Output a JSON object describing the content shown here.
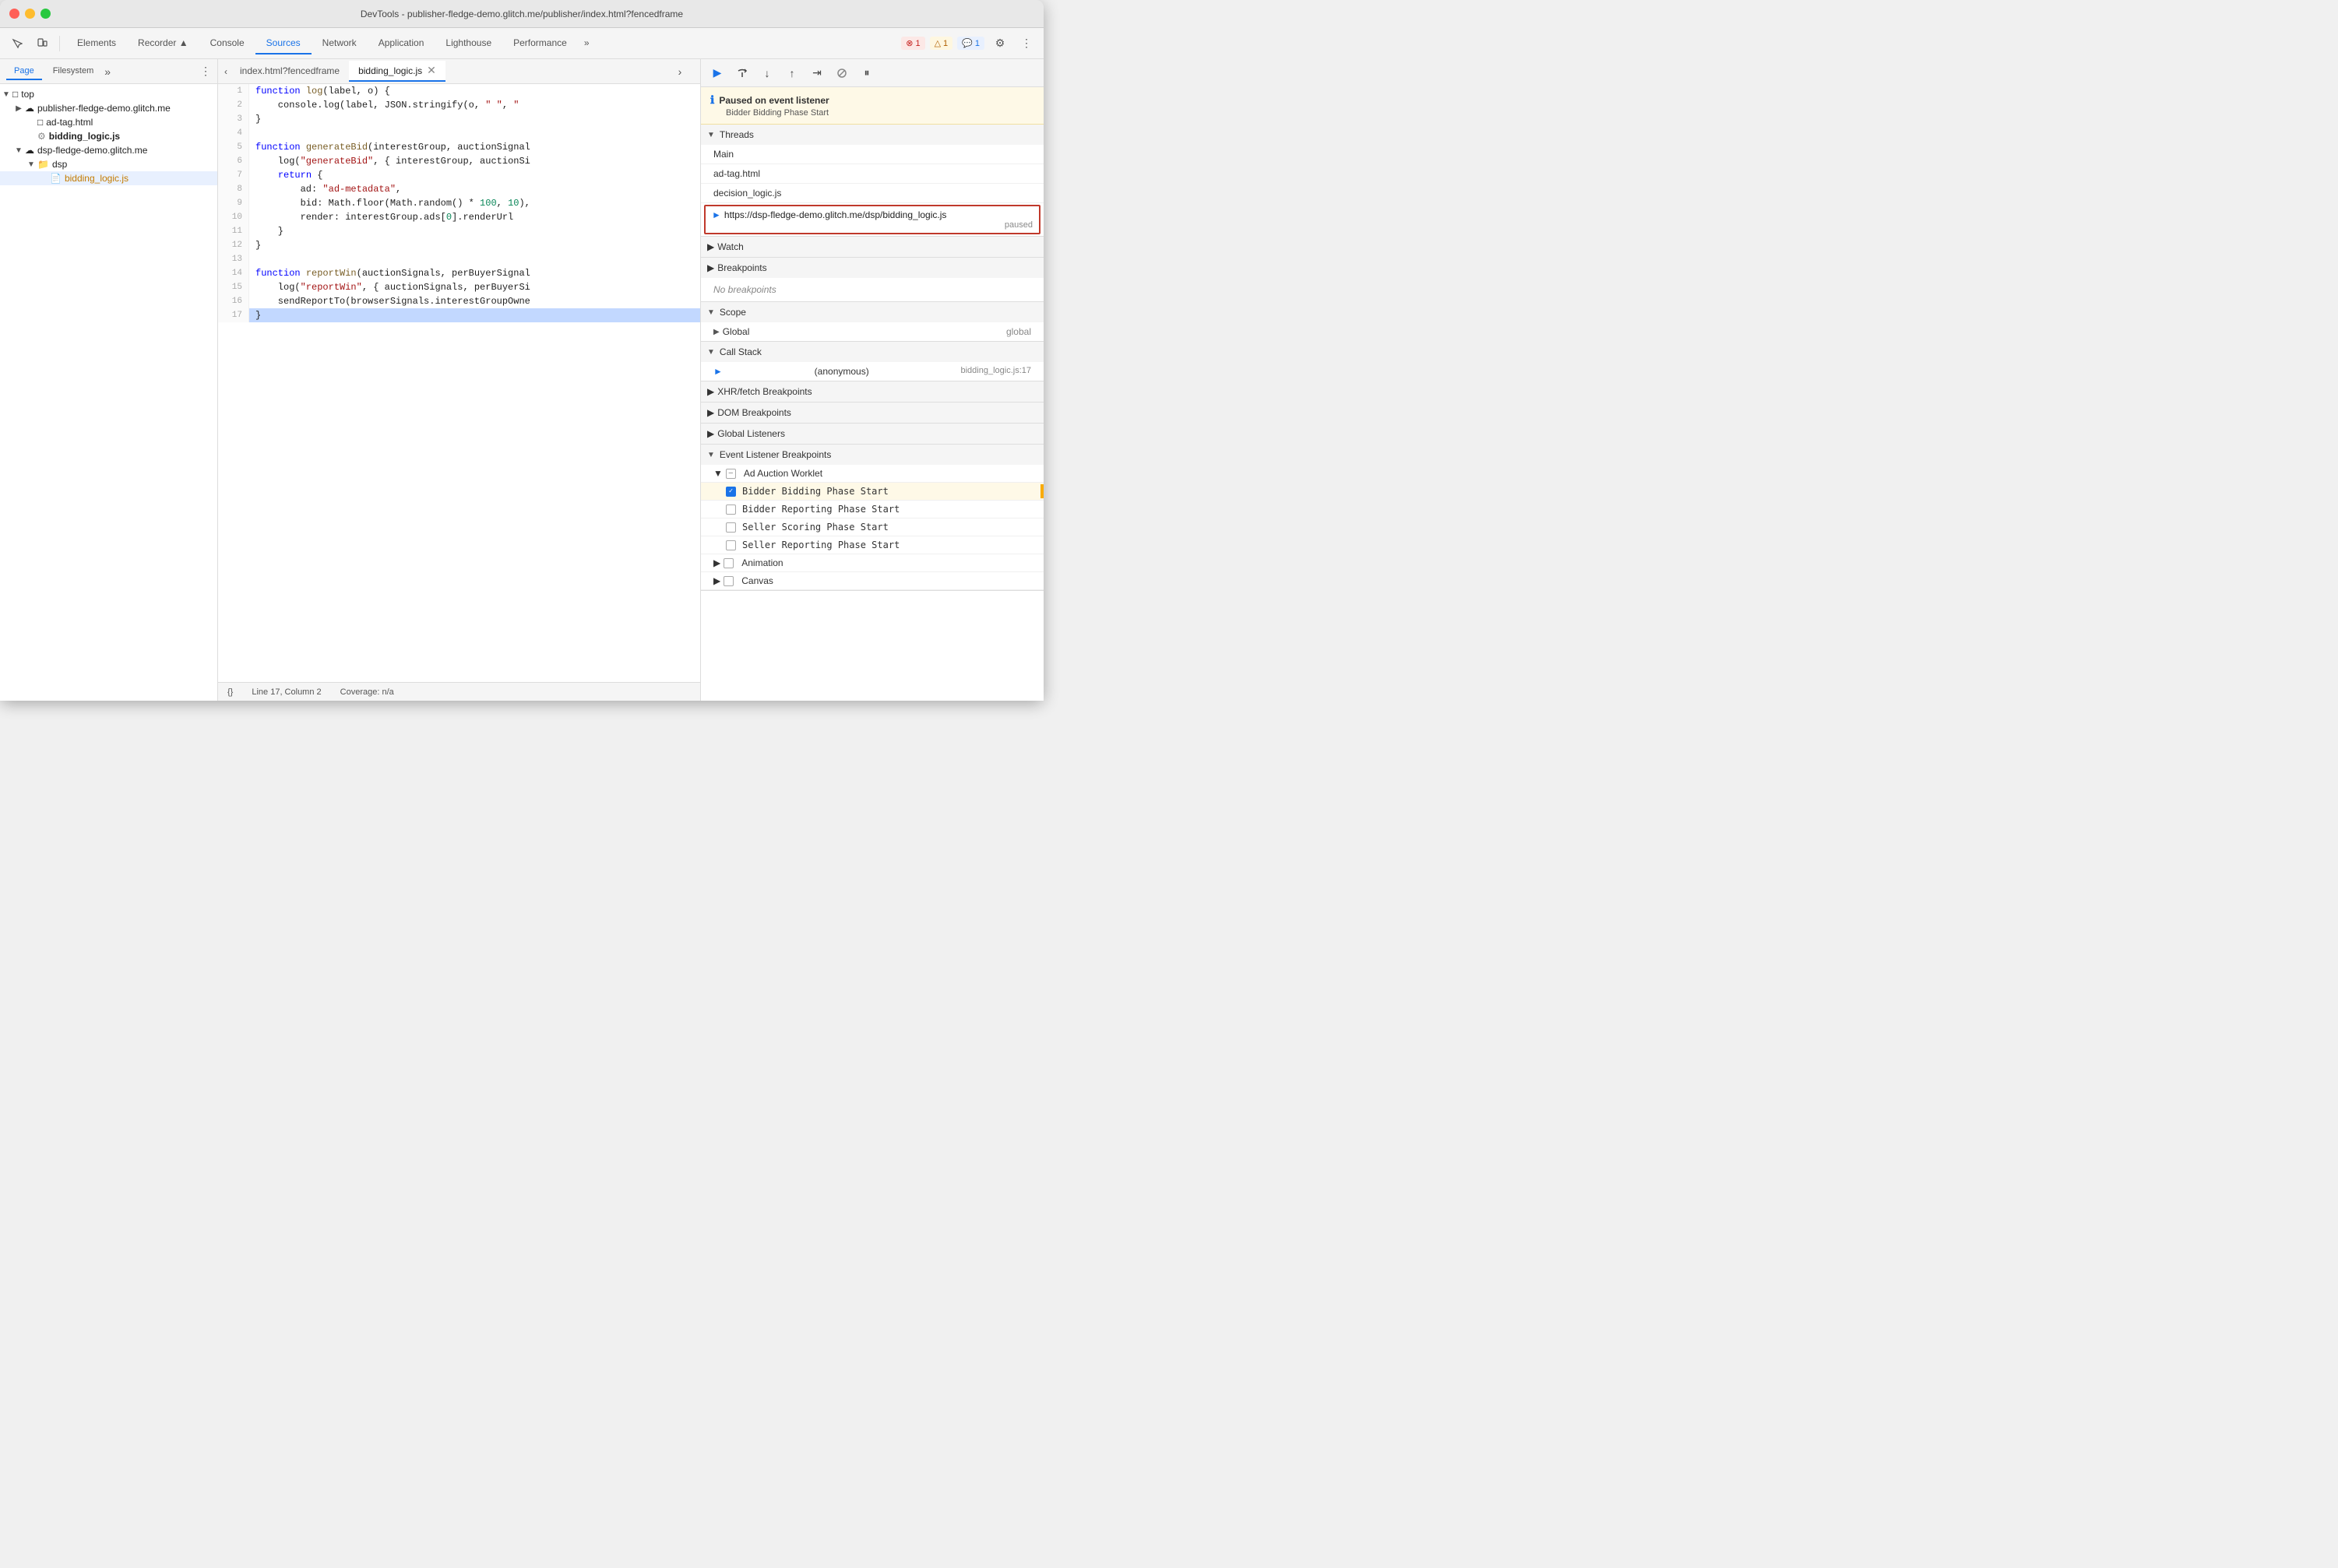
{
  "titlebar": {
    "title": "DevTools - publisher-fledge-demo.glitch.me/publisher/index.html?fencedframe"
  },
  "toolbar": {
    "tabs": [
      {
        "label": "Elements",
        "active": false
      },
      {
        "label": "Recorder ▲",
        "active": false
      },
      {
        "label": "Console",
        "active": false
      },
      {
        "label": "Sources",
        "active": true
      },
      {
        "label": "Network",
        "active": false
      },
      {
        "label": "Application",
        "active": false
      },
      {
        "label": "Lighthouse",
        "active": false
      },
      {
        "label": "Performance",
        "active": false
      }
    ],
    "badges": {
      "error": "1",
      "warning": "1",
      "info": "1"
    }
  },
  "left_panel": {
    "tabs": [
      "Page",
      "Filesystem"
    ],
    "active_tab": "Page",
    "tree": [
      {
        "level": 0,
        "type": "folder",
        "label": "top",
        "expanded": true
      },
      {
        "level": 1,
        "type": "domain",
        "label": "publisher-fledge-demo.glitch.me",
        "expanded": false
      },
      {
        "level": 1,
        "type": "file",
        "label": "ad-tag.html"
      },
      {
        "level": 1,
        "type": "file-special",
        "label": "bidding_logic.js",
        "selected": false,
        "bold": true
      },
      {
        "level": 1,
        "type": "domain",
        "label": "dsp-fledge-demo.glitch.me",
        "expanded": true
      },
      {
        "level": 2,
        "type": "folder-blue",
        "label": "dsp",
        "expanded": true
      },
      {
        "level": 3,
        "type": "file-yellow",
        "label": "bidding_logic.js",
        "selected": true
      }
    ]
  },
  "code_panel": {
    "tabs": [
      {
        "label": "index.html?fencedframe",
        "active": false,
        "closable": false
      },
      {
        "label": "bidding_logic.js",
        "active": true,
        "closable": true
      }
    ],
    "lines": [
      {
        "num": 1,
        "content": "function log(label, o) {"
      },
      {
        "num": 2,
        "content": "    console.log(label, JSON.stringify(o, \" \", \""
      },
      {
        "num": 3,
        "content": "}"
      },
      {
        "num": 4,
        "content": ""
      },
      {
        "num": 5,
        "content": "function generateBid(interestGroup, auctionSignal"
      },
      {
        "num": 6,
        "content": "    log(\"generateBid\", { interestGroup, auctionSi"
      },
      {
        "num": 7,
        "content": "    return {"
      },
      {
        "num": 8,
        "content": "        ad: \"ad-metadata\","
      },
      {
        "num": 9,
        "content": "        bid: Math.floor(Math.random() * 100, 10),"
      },
      {
        "num": 10,
        "content": "        render: interestGroup.ads[0].renderUrl"
      },
      {
        "num": 11,
        "content": "    }"
      },
      {
        "num": 12,
        "content": "}"
      },
      {
        "num": 13,
        "content": ""
      },
      {
        "num": 14,
        "content": "function reportWin(auctionSignals, perBuyerSignal"
      },
      {
        "num": 15,
        "content": "    log(\"reportWin\", { auctionSignals, perBuyerSi"
      },
      {
        "num": 16,
        "content": "    sendReportTo(browserSignals.interestGroupOwne"
      },
      {
        "num": 17,
        "content": "}"
      }
    ],
    "current_line": 17,
    "footer": {
      "format": "{}",
      "position": "Line 17, Column 2",
      "coverage": "Coverage: n/a"
    }
  },
  "right_panel": {
    "paused": {
      "title": "Paused on event listener",
      "subtitle": "Bidder Bidding Phase Start"
    },
    "sections": {
      "threads": {
        "label": "Threads",
        "items": [
          {
            "label": "Main"
          },
          {
            "label": "ad-tag.html"
          },
          {
            "label": "decision_logic.js"
          },
          {
            "label": "https://dsp-fledge-demo.glitch.me/dsp/bidding_logic.js",
            "active": true,
            "paused": "paused"
          }
        ]
      },
      "watch": {
        "label": "Watch"
      },
      "breakpoints": {
        "label": "Breakpoints",
        "empty": "No breakpoints"
      },
      "scope": {
        "label": "Scope",
        "items": [
          {
            "label": "Global",
            "value": "global"
          }
        ]
      },
      "call_stack": {
        "label": "Call Stack",
        "items": [
          {
            "label": "(anonymous)",
            "location": "bidding_logic.js:17",
            "current": true
          }
        ]
      },
      "xhr_breakpoints": {
        "label": "XHR/fetch Breakpoints"
      },
      "dom_breakpoints": {
        "label": "DOM Breakpoints"
      },
      "global_listeners": {
        "label": "Global Listeners"
      },
      "event_listener_breakpoints": {
        "label": "Event Listener Breakpoints",
        "items": [
          {
            "label": "Ad Auction Worklet",
            "expanded": true,
            "children": [
              {
                "label": "Bidder Bidding Phase Start",
                "checked": true,
                "highlighted": true
              },
              {
                "label": "Bidder Reporting Phase Start",
                "checked": false
              },
              {
                "label": "Seller Scoring Phase Start",
                "checked": false
              },
              {
                "label": "Seller Reporting Phase Start",
                "checked": false
              }
            ]
          },
          {
            "label": "Animation",
            "expanded": false
          },
          {
            "label": "Canvas",
            "expanded": false
          }
        ]
      }
    }
  }
}
